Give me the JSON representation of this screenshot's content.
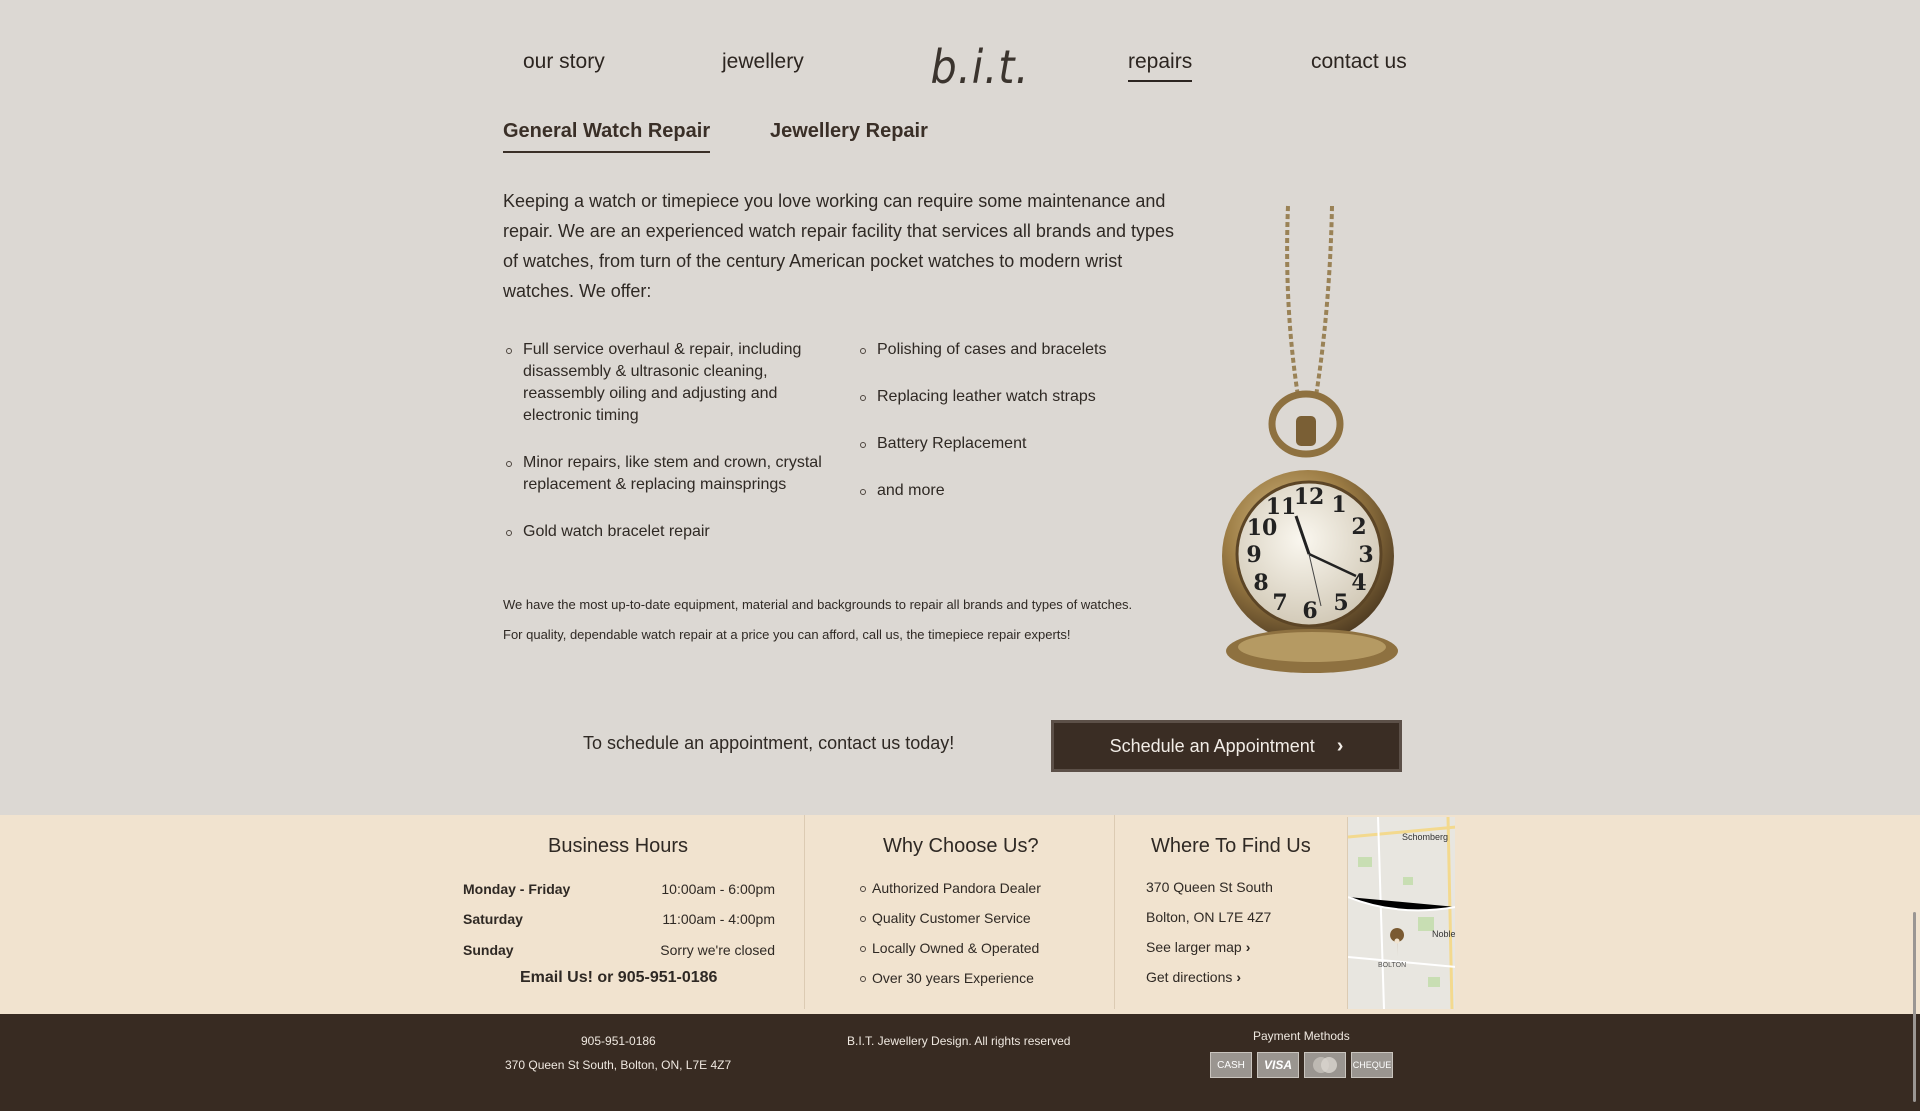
{
  "nav": {
    "logo": "b.i.t.",
    "items": [
      {
        "label": "our story"
      },
      {
        "label": "jewellery"
      },
      {
        "label": "repairs"
      },
      {
        "label": "contact us"
      }
    ],
    "active": "repairs"
  },
  "tabs": [
    {
      "label": "General Watch Repair"
    },
    {
      "label": "Jewellery Repair"
    }
  ],
  "intro": "Keeping a watch or timepiece you love working can require some maintenance and repair. We are an experienced watch repair facility that services all brands and types of watches, from turn of the century American pocket watches to modern wrist watches. We offer:",
  "services_left": [
    "Full service overhaul & repair, including disassembly & ultrasonic cleaning, reassembly oiling and adjusting and electronic timing",
    "Minor repairs, like stem and crown, crystal replacement & replacing mainsprings",
    "Gold watch bracelet repair"
  ],
  "services_right": [
    "Polishing of cases and bracelets",
    "Replacing leather watch straps",
    "Battery Replacement",
    "and more"
  ],
  "notes": [
    "We have the most up-to-date equipment, material and backgrounds to repair all brands and types of watches.",
    "For quality, dependable watch repair at a price you can afford, call us, the timepiece repair experts!"
  ],
  "cta": {
    "text": "To schedule an appointment, contact us today!",
    "button": "Schedule an Appointment",
    "chevron": "›"
  },
  "hours": {
    "title": "Business Hours",
    "rows": [
      {
        "day": "Monday - Friday",
        "time": "10:00am - 6:00pm"
      },
      {
        "day": "Saturday",
        "time": "11:00am - 4:00pm"
      },
      {
        "day": "Sunday",
        "time": "Sorry we're closed"
      }
    ],
    "contact": "Email Us! or 905-951-0186"
  },
  "why": {
    "title": "Why Choose Us?",
    "items": [
      "Authorized Pandora Dealer",
      "Quality Customer Service",
      "Locally Owned & Operated",
      "Over 30 years Experience"
    ]
  },
  "where": {
    "title": "Where To Find Us",
    "address1": "370 Queen St South",
    "address2": "Bolton, ON L7E 4Z7",
    "map_link": "See larger map",
    "directions_link": "Get directions",
    "chevron": "›"
  },
  "map": {
    "labels": [
      "Schomberg",
      "Noble",
      "BOLTON"
    ]
  },
  "footer": {
    "phone": "905-951-0186",
    "address": "370 Queen St South, Bolton, ON, L7E 4Z7",
    "rights": "B.I.T. Jewellery Design. All rights reserved",
    "payment_title": "Payment Methods",
    "payments": [
      "CASH",
      "VISA",
      "MC",
      "CHEQUE"
    ]
  },
  "colors": {
    "background": "#dcd8d3",
    "info_strip": "#f1e3cf",
    "footer": "#382b22",
    "button": "#3a2d24"
  }
}
